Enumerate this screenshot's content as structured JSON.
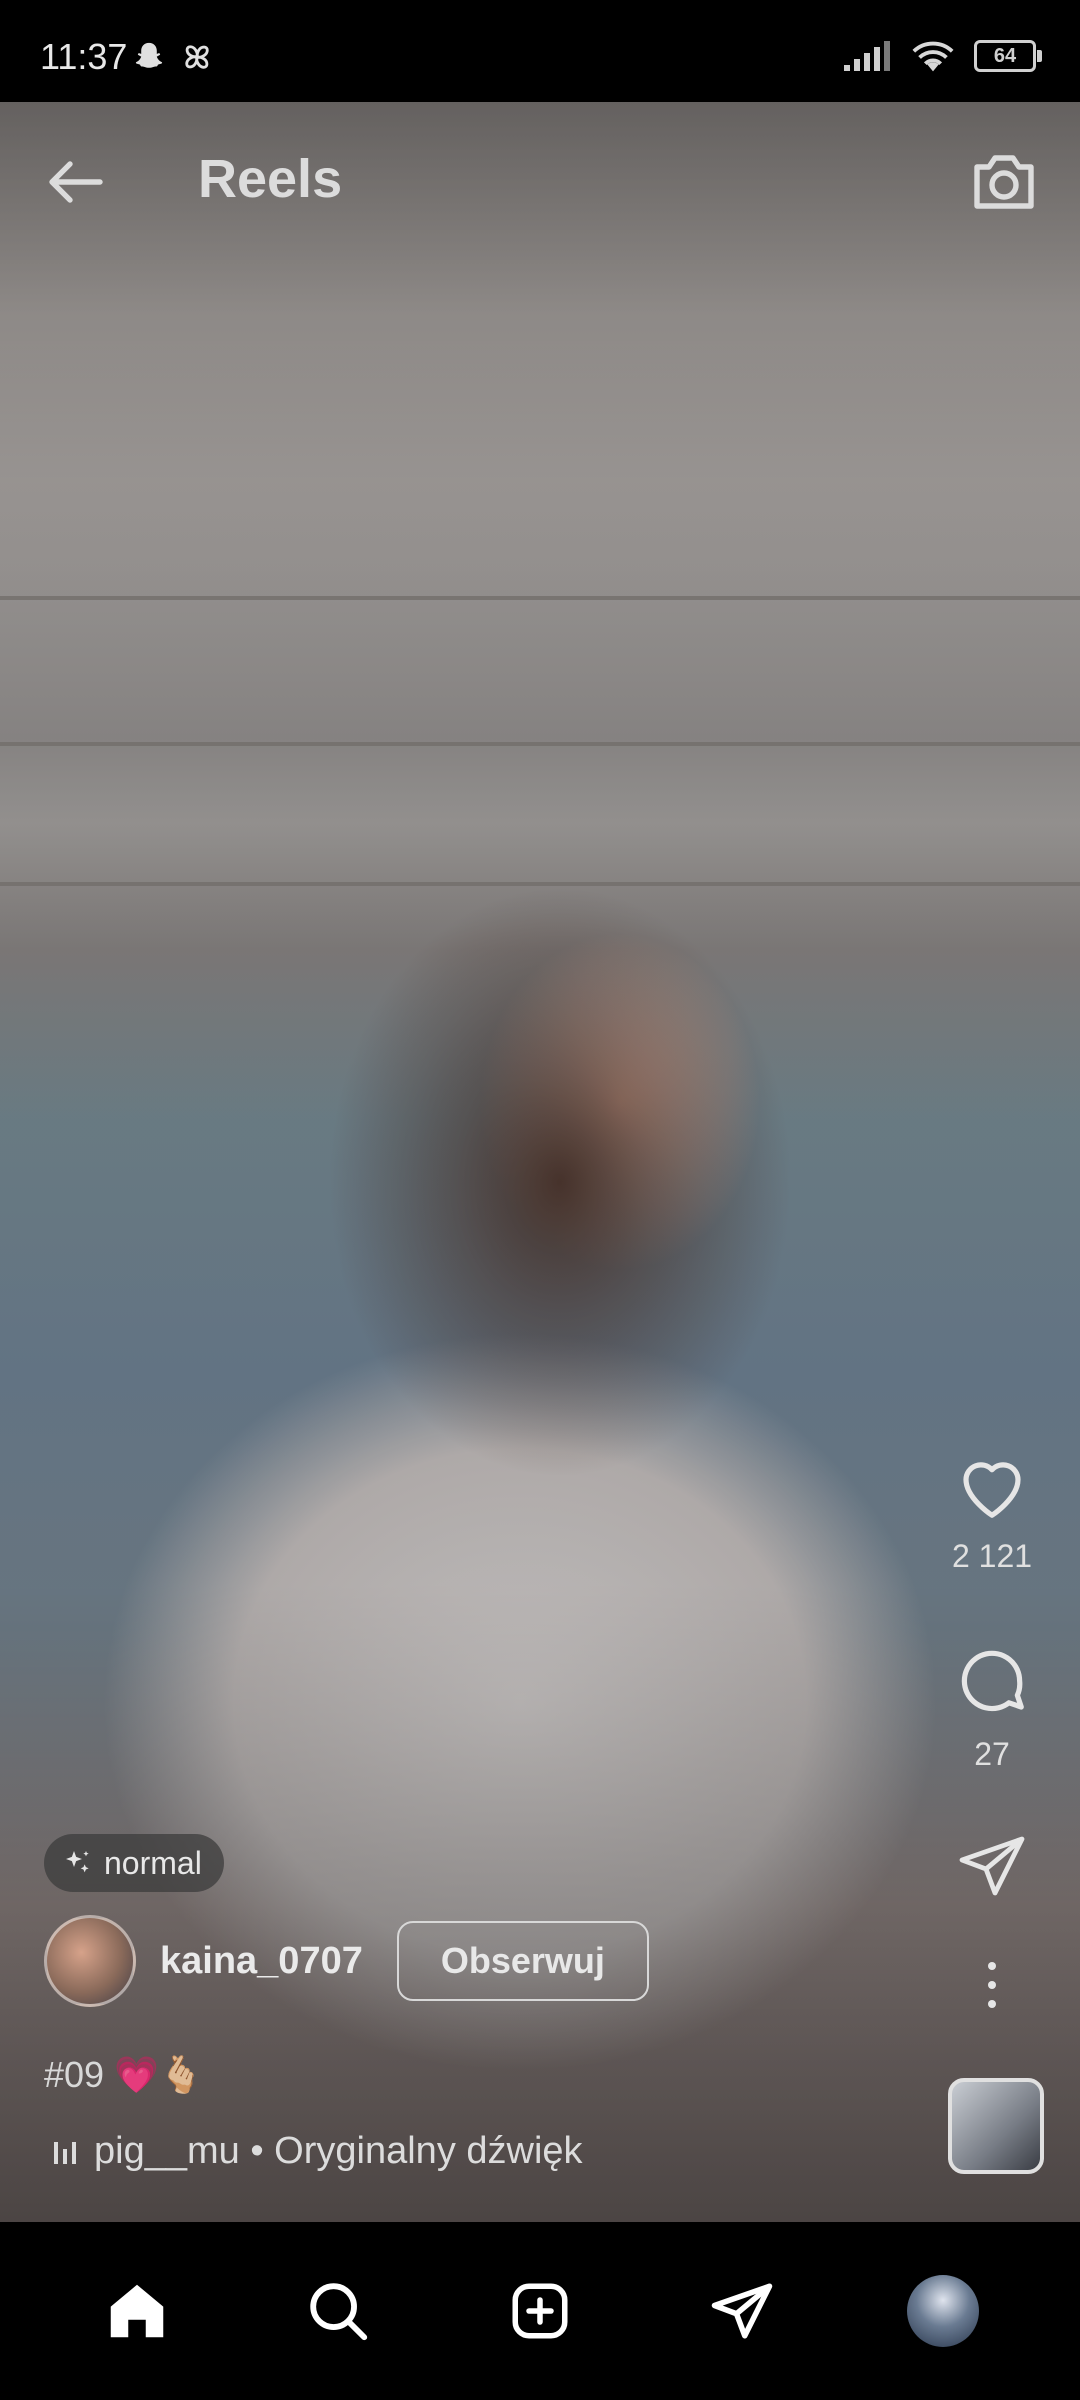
{
  "status_bar": {
    "time": "11:37",
    "battery": "64",
    "left_icons": [
      "snapchat-icon",
      "pinwheel-icon"
    ],
    "right_icons": [
      "signal-icon",
      "wifi-icon",
      "battery-icon"
    ]
  },
  "header": {
    "title": "Reels",
    "back_icon": "arrow-left-icon",
    "camera_icon": "camera-icon"
  },
  "actions": {
    "likes": "2 121",
    "comments": "27",
    "like_icon": "heart-icon",
    "comment_icon": "comment-icon",
    "share_icon": "send-icon",
    "more_icon": "more-vertical-icon"
  },
  "post": {
    "effect_label": "normal",
    "username": "kaina_0707",
    "follow_label": "Obserwuj",
    "caption": "#09 💗🫰🏼",
    "audio": "pig__mu • Oryginalny dźwięk"
  },
  "bottom_nav": [
    {
      "name": "home",
      "icon": "home-icon"
    },
    {
      "name": "search",
      "icon": "search-icon"
    },
    {
      "name": "create",
      "icon": "plus-square-icon"
    },
    {
      "name": "direct",
      "icon": "send-icon"
    },
    {
      "name": "profile",
      "icon": "profile-avatar"
    }
  ],
  "colors": {
    "bar_background": "#000000",
    "text": "#E8E8E8"
  }
}
